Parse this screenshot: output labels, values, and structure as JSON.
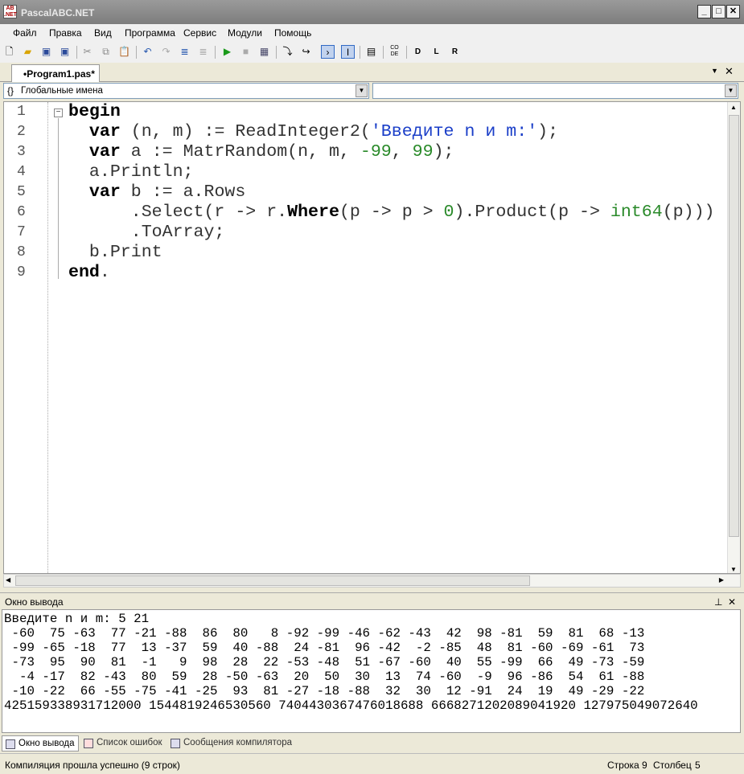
{
  "window": {
    "title": "PascalABC.NET",
    "minimize": "_",
    "maximize": "□",
    "close": "✕"
  },
  "menu": [
    "Файл",
    "Правка",
    "Вид",
    "Программа",
    "Сервис",
    "Модули",
    "Помощь"
  ],
  "toolbar_icons": [
    "new-file",
    "open",
    "save",
    "save-all",
    "cut",
    "copy",
    "paste",
    "undo",
    "redo",
    "format",
    "format-all",
    "run",
    "stop",
    "compile",
    "step-into",
    "step-over",
    "console-output",
    "toggle-output",
    "breakpoint",
    "code-templates",
    "debug-d",
    "debug-l",
    "debug-r"
  ],
  "tab": {
    "label": "•Program1.pas*"
  },
  "combo_left": {
    "value": "Глобальные имена",
    "icon": "{}"
  },
  "combo_right": {
    "value": ""
  },
  "code": {
    "line_numbers": [
      "1",
      "2",
      "3",
      "4",
      "5",
      "6",
      "7",
      "8",
      "9"
    ],
    "lines": [
      [
        [
          "kw",
          "begin"
        ]
      ],
      [
        [
          "id",
          "  "
        ],
        [
          "kw",
          "var"
        ],
        [
          "id",
          " (n, m) := ReadInteger2("
        ],
        [
          "str",
          "'Введите n и m:'"
        ],
        [
          "id",
          ");"
        ]
      ],
      [
        [
          "id",
          "  "
        ],
        [
          "kw",
          "var"
        ],
        [
          "id",
          " a := MatrRandom(n, m, "
        ],
        [
          "num",
          "-99"
        ],
        [
          "id",
          ", "
        ],
        [
          "num",
          "99"
        ],
        [
          "id",
          ");"
        ]
      ],
      [
        [
          "id",
          "  a.Println;"
        ]
      ],
      [
        [
          "id",
          "  "
        ],
        [
          "kw",
          "var"
        ],
        [
          "id",
          " b := a.Rows"
        ]
      ],
      [
        [
          "id",
          "      .Select(r -> r."
        ],
        [
          "kw",
          "Where"
        ],
        [
          "id",
          "(p -> p > "
        ],
        [
          "num",
          "0"
        ],
        [
          "id",
          ").Product(p -> "
        ],
        [
          "typ",
          "int64"
        ],
        [
          "id",
          "(p)))"
        ]
      ],
      [
        [
          "id",
          "      .ToArray;"
        ]
      ],
      [
        [
          "id",
          "  b.Print"
        ]
      ],
      [
        [
          "kw",
          "end"
        ],
        [
          "id",
          "."
        ]
      ]
    ]
  },
  "output_panel": {
    "title": "Окно вывода",
    "pin": "📌",
    "close": "✕",
    "lines": [
      "Введите n и m: 5 21",
      " -60  75 -63  77 -21 -88  86  80   8 -92 -99 -46 -62 -43  42  98 -81  59  81  68 -13",
      " -99 -65 -18  77  13 -37  59  40 -88  24 -81  96 -42  -2 -85  48  81 -60 -69 -61  73",
      " -73  95  90  81  -1   9  98  28  22 -53 -48  51 -67 -60  40  55 -99  66  49 -73 -59",
      "  -4 -17  82 -43  80  59  28 -50 -63  20  50  30  13  74 -60  -9  96 -86  54  61 -88",
      " -10 -22  66 -55 -75 -41 -25  93  81 -27 -18 -88  32  30  12 -91  24  19  49 -29 -22",
      "425159338931712000 1544819246530560 7404430367476018688 6668271202089041920 127975049072640"
    ]
  },
  "bottom_tabs": [
    "Окно вывода",
    "Список ошибок",
    "Сообщения компилятора"
  ],
  "status": {
    "message": "Компиляция прошла успешно (9 строк)",
    "row_label": "Строка",
    "row": "9",
    "col_label": "Столбец",
    "col": "5"
  }
}
